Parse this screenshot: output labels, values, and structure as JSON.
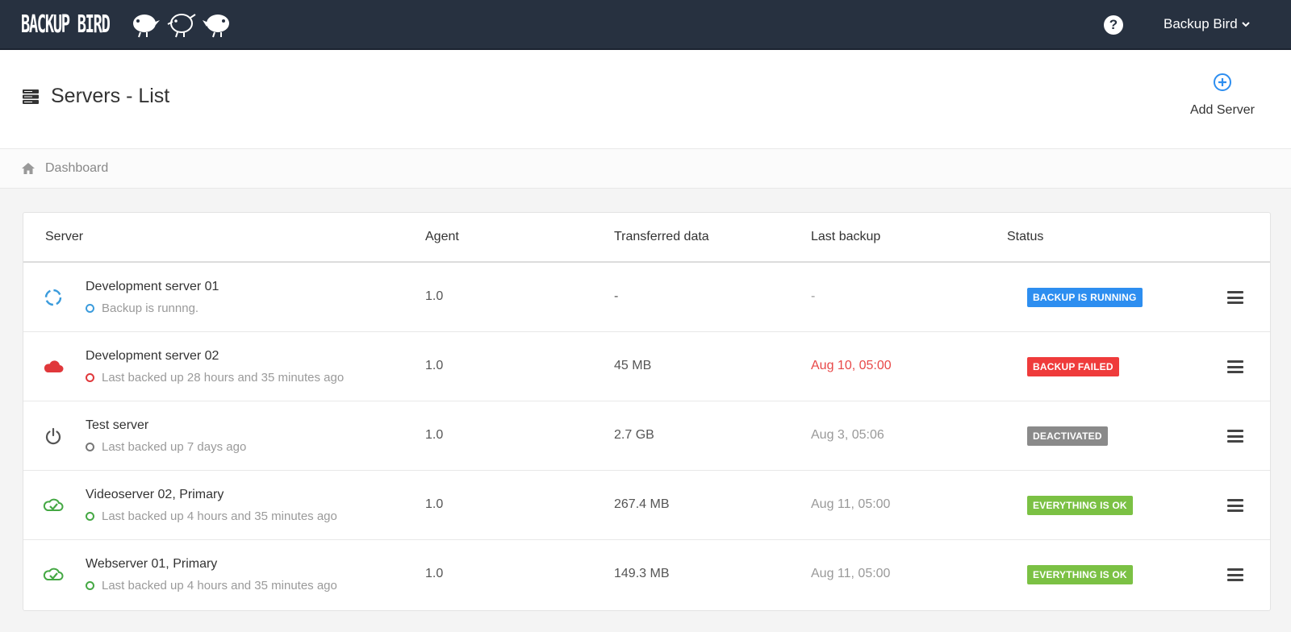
{
  "header": {
    "logo_text": "BACKUP BIRD",
    "help_label": "?",
    "user_name": "Backup Bird"
  },
  "page": {
    "title": "Servers - List",
    "add_server_label": "Add Server"
  },
  "breadcrumb": {
    "label": "Dashboard"
  },
  "table": {
    "columns": [
      "Server",
      "Agent",
      "Transferred data",
      "Last backup",
      "Status"
    ],
    "rows": [
      {
        "icon": "spinner-icon",
        "name": "Development server 01",
        "sub": "Backup is runnng.",
        "sub_color": "#3a9bdc",
        "agent": "1.0",
        "transferred": "-",
        "last_backup": "-",
        "last_backup_color": "#999999",
        "status": "BACKUP IS RUNNING",
        "status_color": "#2d8ef0"
      },
      {
        "icon": "cloud-error-icon",
        "name": "Development server 02",
        "sub": "Last backed up 28 hours and 35 minutes ago",
        "sub_color": "#e0383b",
        "agent": "1.0",
        "transferred": "45 MB",
        "last_backup": "Aug 10, 05:00",
        "last_backup_color": "#e84848",
        "status": "BACKUP FAILED",
        "status_color": "#ef3b3b"
      },
      {
        "icon": "power-icon",
        "name": "Test server",
        "sub": "Last backed up 7 days ago",
        "sub_color": "#777777",
        "agent": "1.0",
        "transferred": "2.7 GB",
        "last_backup": "Aug 3, 05:06",
        "last_backup_color": "#999999",
        "status": "DEACTIVATED",
        "status_color": "#8a8a8a"
      },
      {
        "icon": "cloud-check-icon",
        "name": "Videoserver 02, Primary",
        "sub": "Last backed up 4 hours and 35 minutes ago",
        "sub_color": "#45a844",
        "agent": "1.0",
        "transferred": "267.4 MB",
        "last_backup": "Aug 11, 05:00",
        "last_backup_color": "#999999",
        "status": "EVERYTHING IS OK",
        "status_color": "#7bc144"
      },
      {
        "icon": "cloud-check-icon",
        "name": "Webserver 01, Primary",
        "sub": "Last backed up 4 hours and 35 minutes ago",
        "sub_color": "#45a844",
        "agent": "1.0",
        "transferred": "149.3 MB",
        "last_backup": "Aug 11, 05:00",
        "last_backup_color": "#999999",
        "status": "EVERYTHING IS OK",
        "status_color": "#7bc144"
      }
    ]
  },
  "colors": {
    "topbar": "#273140",
    "accent": "#2d8ef0"
  }
}
